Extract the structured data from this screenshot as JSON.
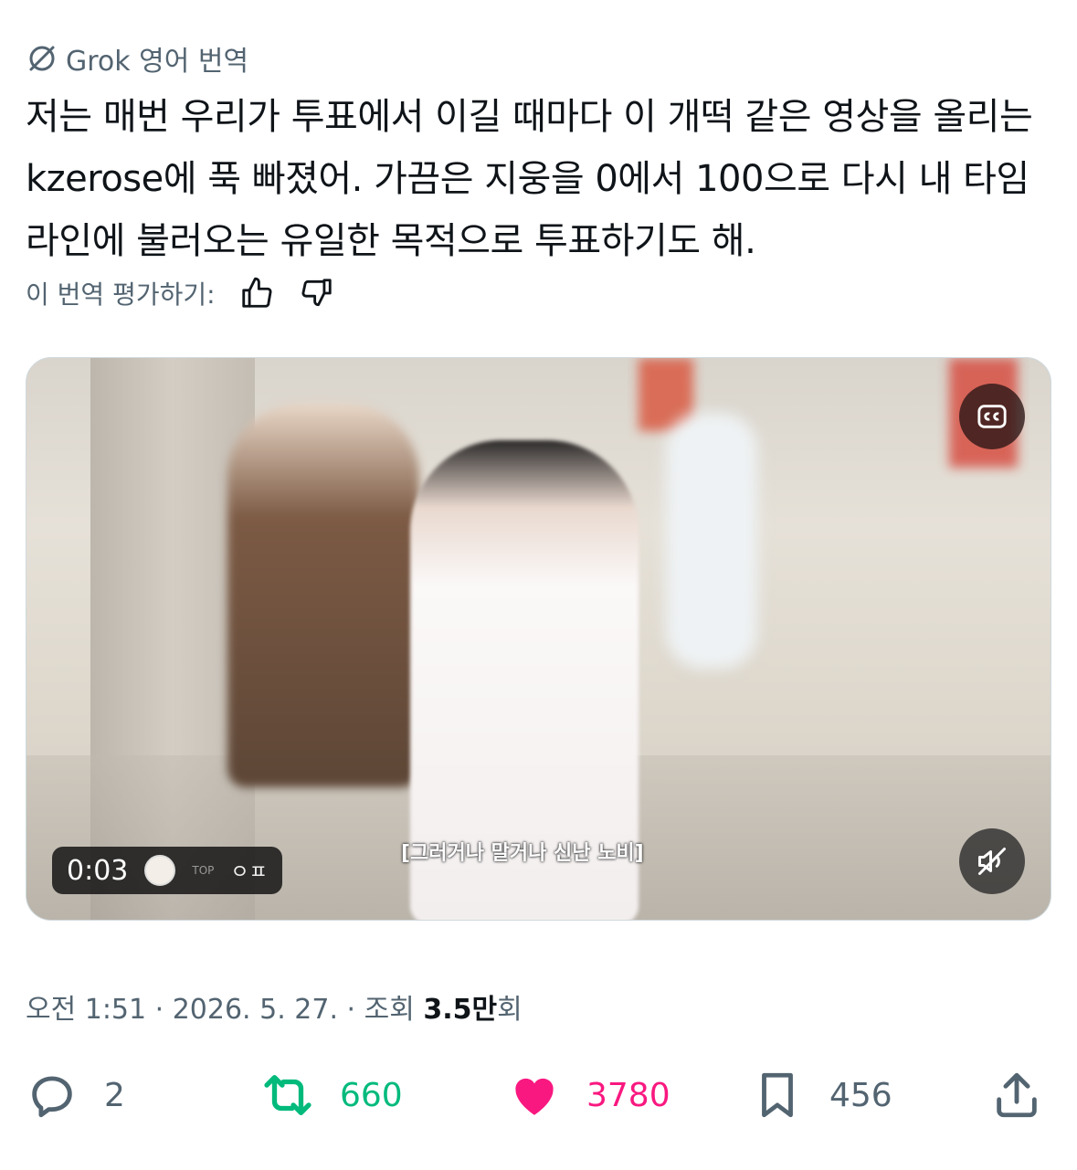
{
  "translation": {
    "label": "Grok 영어 번역",
    "icon": "grok-icon"
  },
  "tweet": {
    "text": "저는 매번 우리가 투표에서 이길 때마다 이 개떡 같은 영상을 올리는 kzerose에 푹 빠졌어. 가끔은 지웅을 0에서 100으로 다시 내 타임라인에 불러오는 유일한 목적으로 투표하기도 해."
  },
  "rating": {
    "label": "이 번역 평가하기:",
    "up_icon": "thumbs-up-icon",
    "down_icon": "thumbs-down-icon"
  },
  "video": {
    "time": "0:03",
    "watermark_top": "TOP",
    "watermark_text": "ㅇㅍ",
    "subtitle": "[그러거나 말거나 신난 노비]",
    "cc_icon": "closed-captions-icon",
    "mute_icon": "muted-speaker-icon"
  },
  "meta": {
    "time_date": "오전 1:51 · 2026. 5. 27. · 조회 ",
    "views": "3.5만",
    "views_suffix": "회"
  },
  "actions": {
    "replies": "2",
    "retweets": "660",
    "likes": "3780",
    "bookmarks": "456"
  },
  "colors": {
    "text": "#0f1419",
    "secondary": "#536471",
    "retweet": "#00ba7c",
    "like": "#f91880"
  }
}
